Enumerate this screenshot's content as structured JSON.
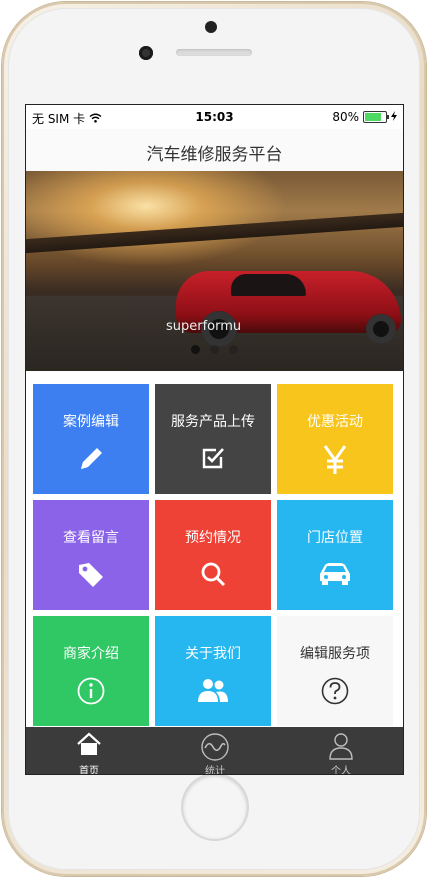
{
  "status_bar": {
    "carrier": "无 SIM 卡",
    "time": "15:03",
    "battery_text": "80%",
    "battery_level": 0.8
  },
  "navbar": {
    "title": "汽车维修服务平台"
  },
  "banner": {
    "caption": "superformu",
    "pages": 3,
    "active_page": 1
  },
  "tiles": [
    {
      "label": "案例编辑",
      "color": "#3d7ff0",
      "icon": "pencil-icon"
    },
    {
      "label": "服务产品上传",
      "color": "#444444",
      "icon": "checkbox-icon"
    },
    {
      "label": "优惠活动",
      "color": "#f8c51c",
      "icon": "yen-icon"
    },
    {
      "label": "查看留言",
      "color": "#8a63e8",
      "icon": "tag-icon"
    },
    {
      "label": "预约情况",
      "color": "#ee4236",
      "icon": "search-icon"
    },
    {
      "label": "门店位置",
      "color": "#27b7f0",
      "icon": "car-icon"
    },
    {
      "label": "商家介绍",
      "color": "#2fc864",
      "icon": "info-icon"
    },
    {
      "label": "关于我们",
      "color": "#27b7f0",
      "icon": "users-icon"
    },
    {
      "label": "编辑服务项",
      "color": "#f7f7f7",
      "icon": "help-icon"
    }
  ],
  "tabbar": {
    "items": [
      {
        "label": "首页",
        "icon": "home-icon",
        "active": true
      },
      {
        "label": "统计",
        "icon": "chart-wave-icon",
        "active": false
      },
      {
        "label": "个人",
        "icon": "person-icon",
        "active": false
      }
    ]
  }
}
